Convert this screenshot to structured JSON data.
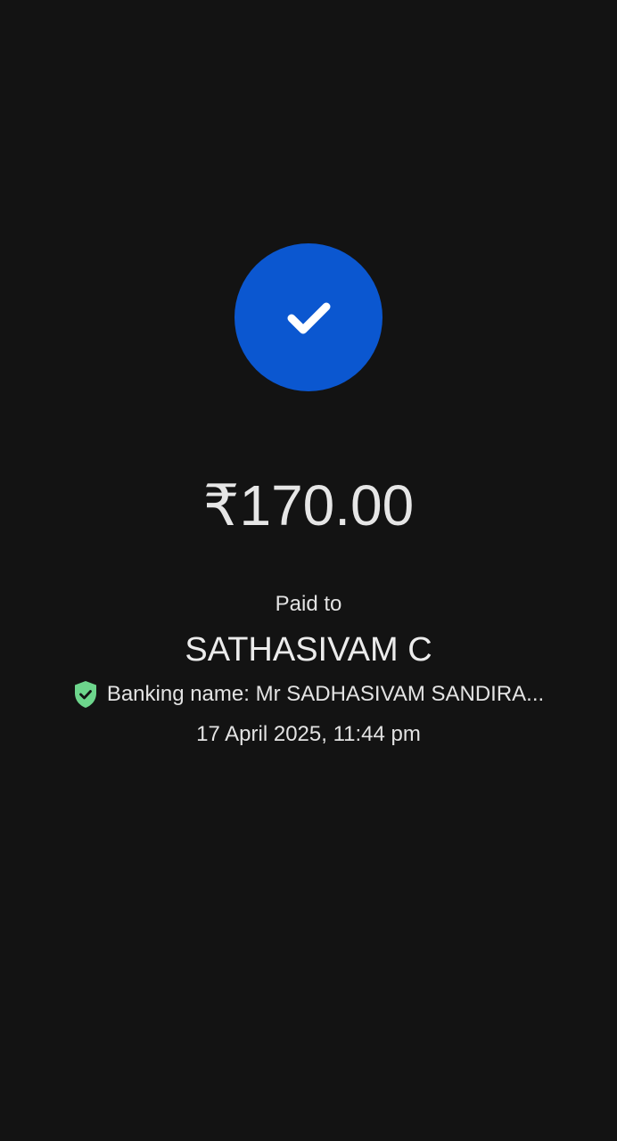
{
  "payment": {
    "status_icon": "checkmark-icon",
    "amount": "₹170.00",
    "paid_to_label": "Paid to",
    "payee_name": "SATHASIVAM C",
    "banking_name": "Banking name: Mr SADHASIVAM SANDIRA...",
    "verified_icon": "verified-shield-icon",
    "datetime": "17 April 2025, 11:44 pm"
  },
  "colors": {
    "background": "#131313",
    "success_circle": "#0b57d0",
    "verified_shield": "#6dd58c",
    "text": "#e3e3e3"
  }
}
